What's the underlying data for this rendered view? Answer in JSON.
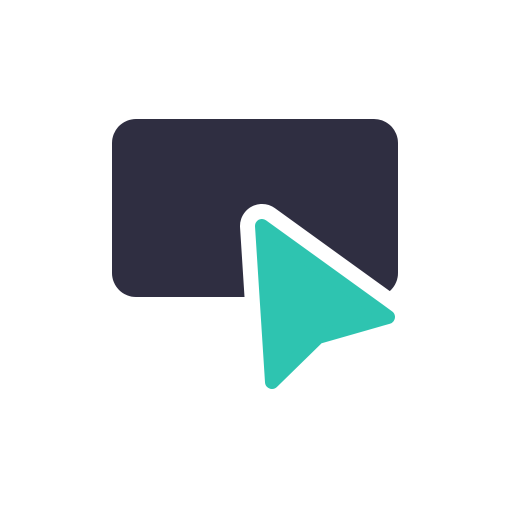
{
  "logo": {
    "icon": "screen-cursor-logo-icon",
    "colors": {
      "background": "#ffffff",
      "screen": "#2f2e41",
      "cursor": "#2ec4b0",
      "outline": "#ffffff"
    }
  }
}
